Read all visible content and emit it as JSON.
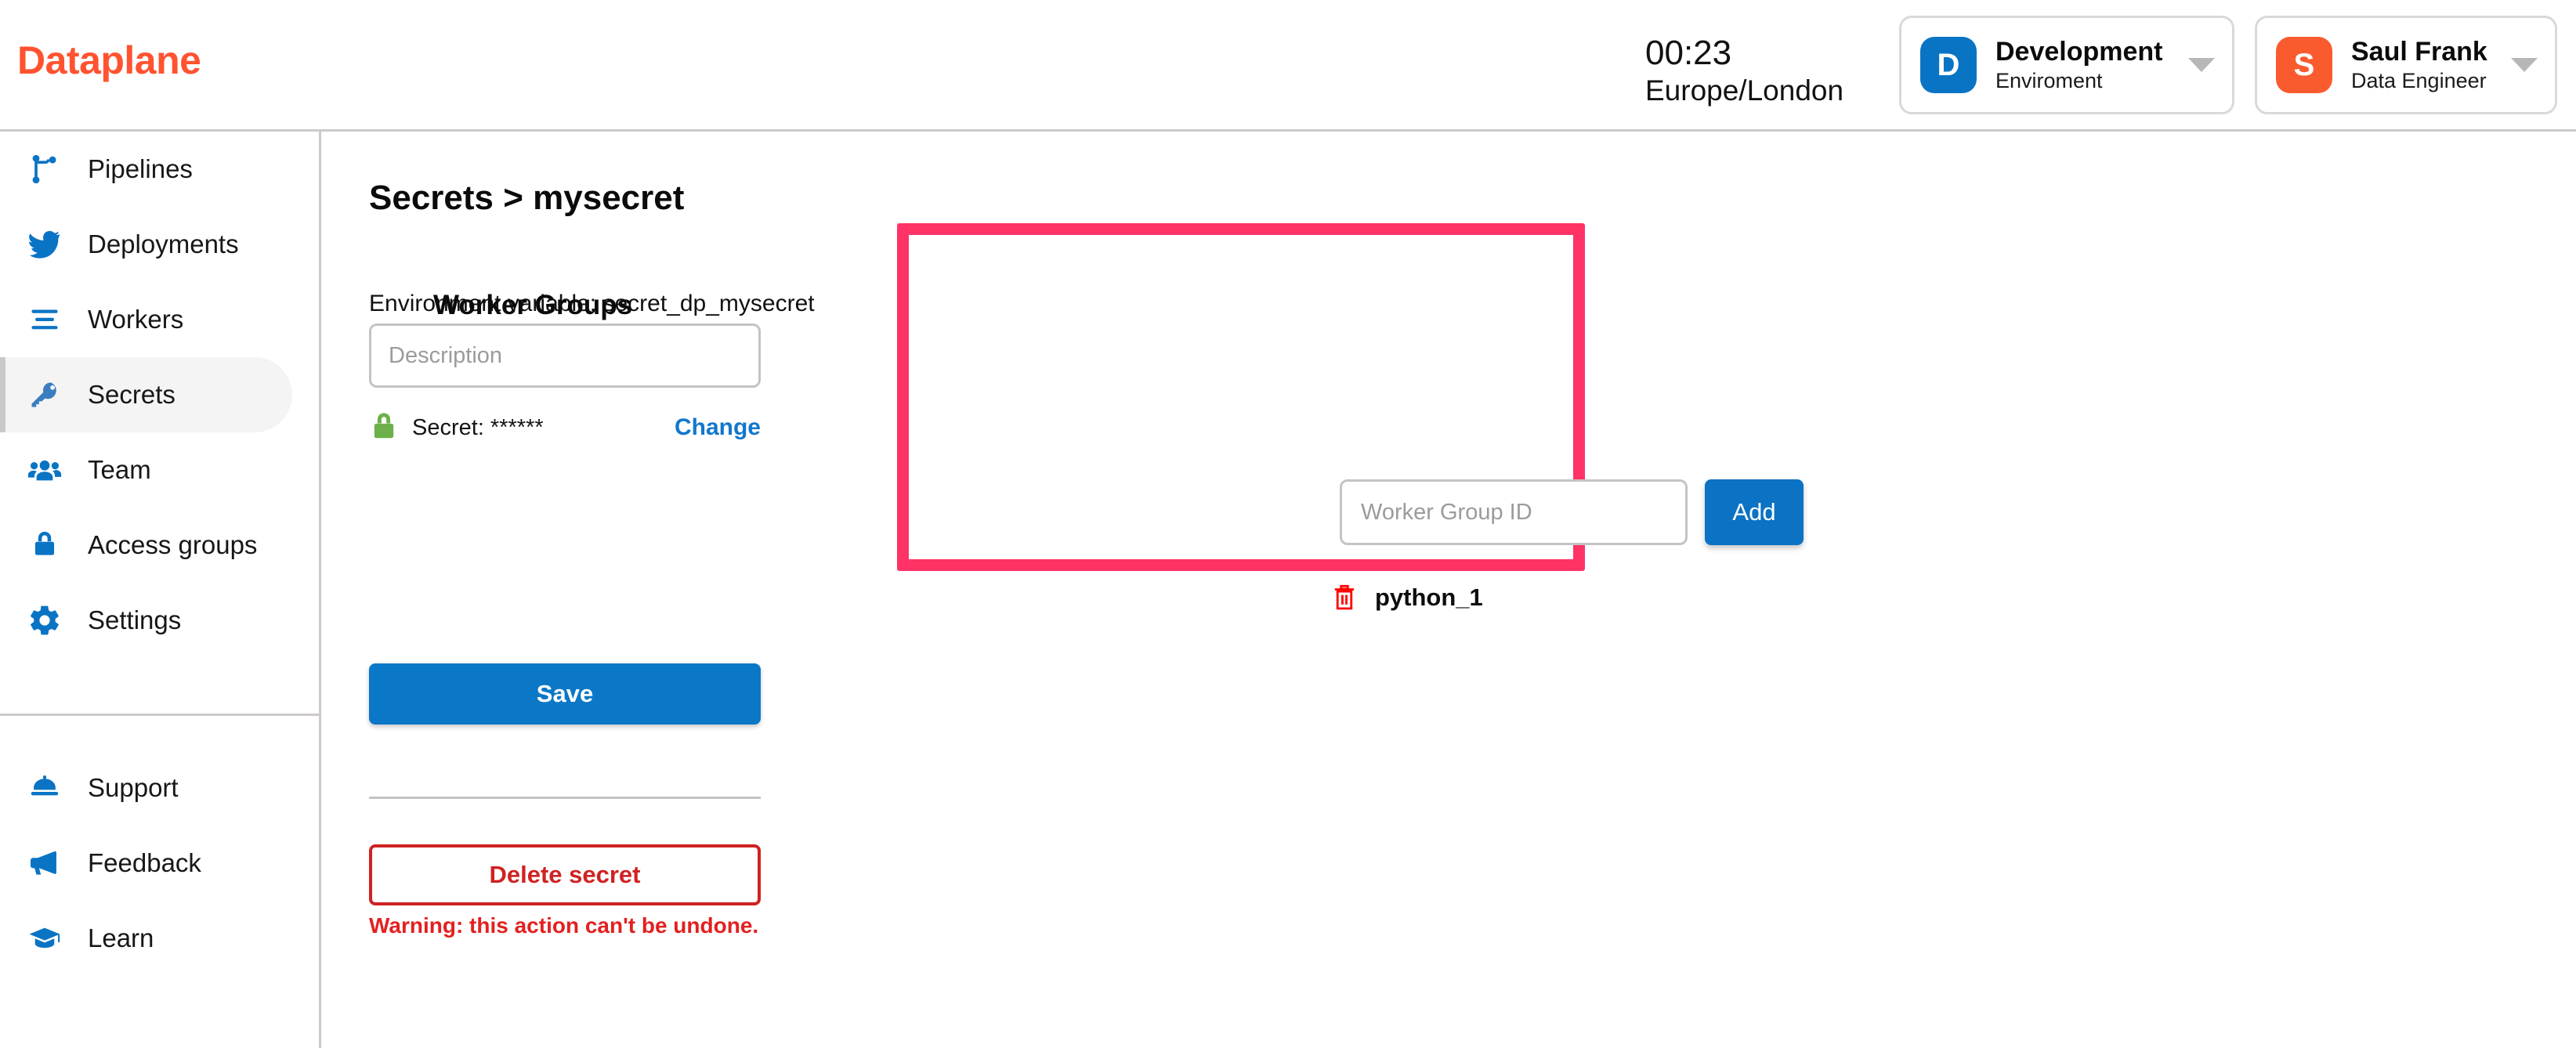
{
  "app": {
    "logo": "Dataplane",
    "brand_color": "#FF5330",
    "accent_blue": "#0a74c4",
    "highlight_color": "#FF3366"
  },
  "header": {
    "clock": {
      "time": "00:23",
      "timezone": "Europe/London"
    },
    "environment_selector": {
      "badge": "D",
      "name": "Development",
      "subtitle": "Enviroment"
    },
    "user_selector": {
      "badge": "S",
      "name": "Saul Frank",
      "subtitle": "Data Engineer"
    }
  },
  "sidebar": {
    "primary_items": [
      {
        "label": "Pipelines",
        "icon": "git-branch-icon",
        "active": false
      },
      {
        "label": "Deployments",
        "icon": "bird-icon",
        "active": false
      },
      {
        "label": "Workers",
        "icon": "list-lines-icon",
        "active": false
      },
      {
        "label": "Secrets",
        "icon": "key-icon",
        "active": true
      },
      {
        "label": "Team",
        "icon": "people-icon",
        "active": false
      },
      {
        "label": "Access groups",
        "icon": "lock-icon",
        "active": false
      },
      {
        "label": "Settings",
        "icon": "gear-icon",
        "active": false
      }
    ],
    "secondary_items": [
      {
        "label": "Support",
        "icon": "bell-icon"
      },
      {
        "label": "Feedback",
        "icon": "megaphone-icon"
      },
      {
        "label": "Learn",
        "icon": "graduation-cap-icon"
      }
    ]
  },
  "main": {
    "page_title": "Secrets > mysecret",
    "environment_variable": "Environment variable: secret_dp_mysecret",
    "description_placeholder": "Description",
    "description_value": "",
    "secret_label": "Secret: ******",
    "change_link": "Change",
    "save_label": "Save",
    "delete_label": "Delete secret",
    "warning": "Warning: this action can't be undone."
  },
  "worker_groups": {
    "title": "Worker Groups",
    "input_placeholder": "Worker Group ID",
    "input_value": "",
    "add_label": "Add",
    "items": [
      {
        "name": "python_1",
        "delete_icon": "trash-icon"
      }
    ]
  }
}
